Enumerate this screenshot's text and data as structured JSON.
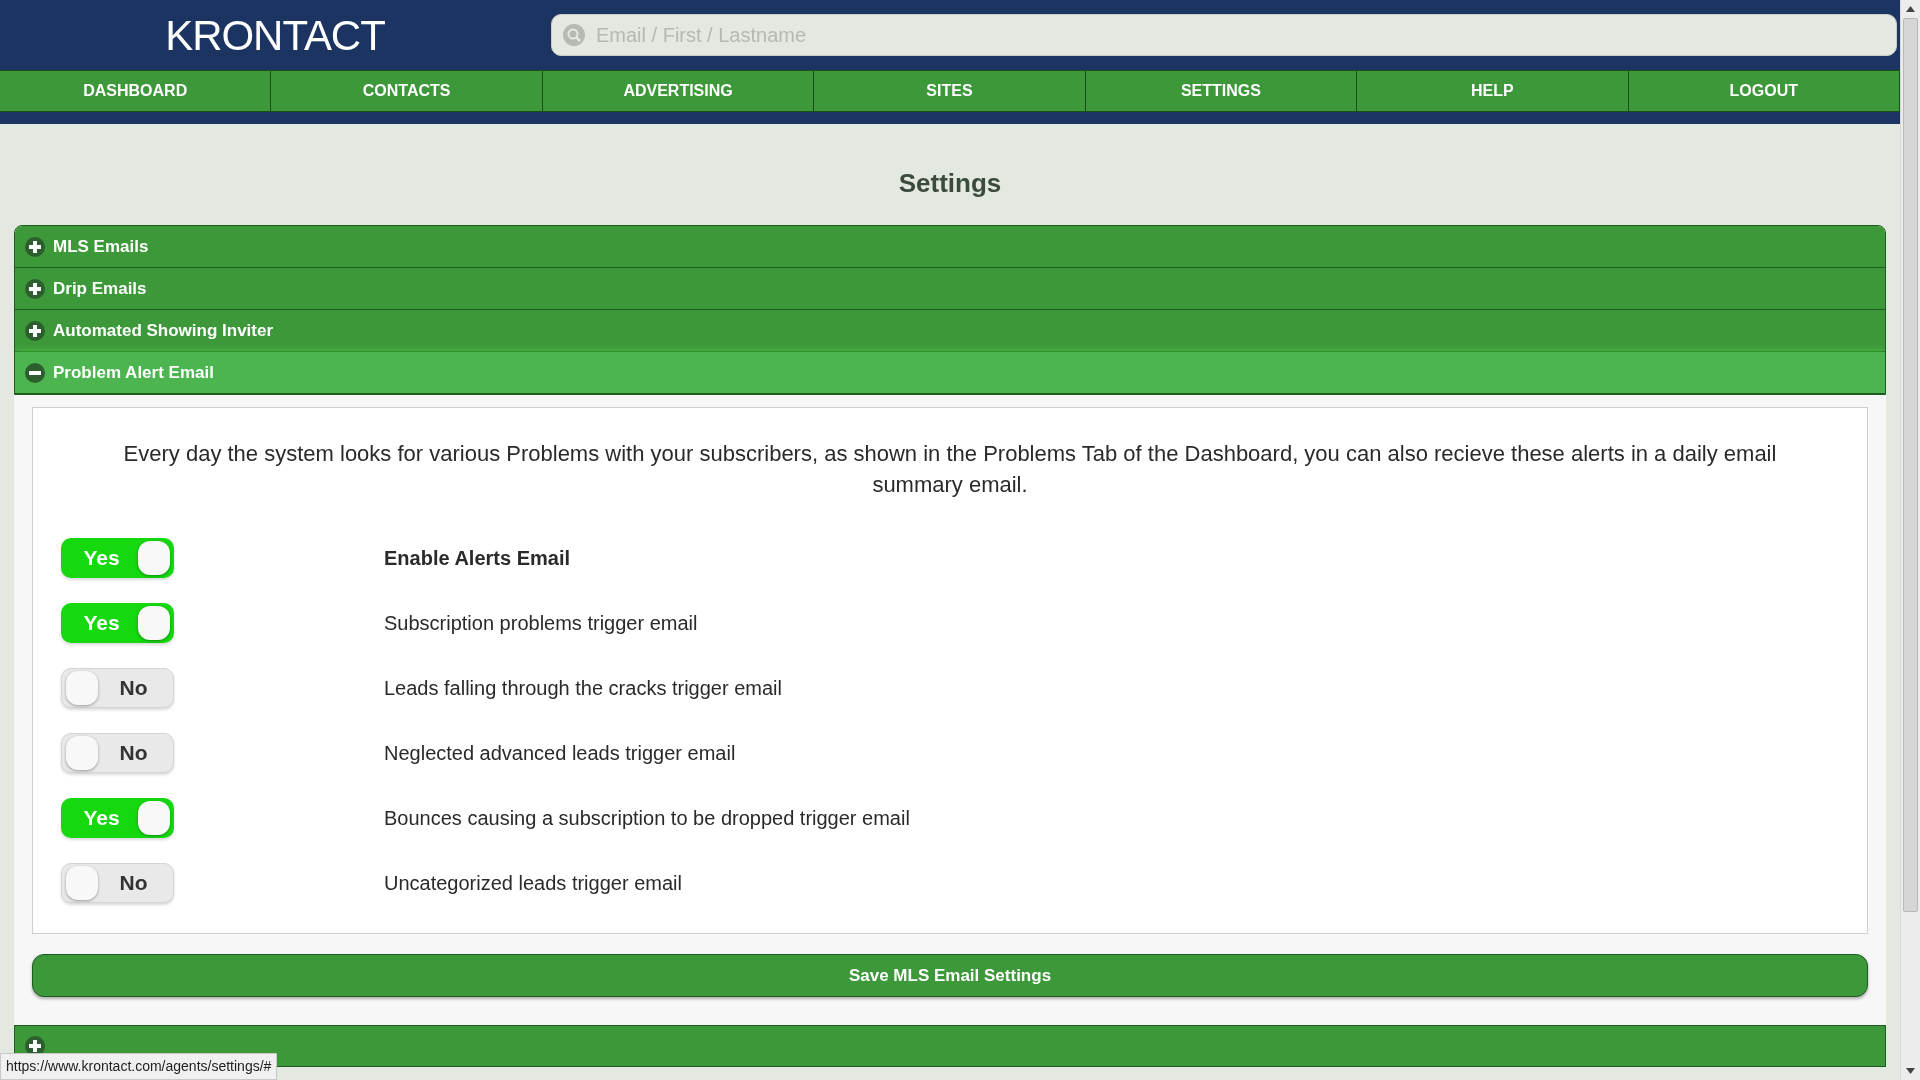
{
  "header": {
    "brand": "KRONTACT",
    "search": {
      "placeholder": "Email / First / Lastname"
    }
  },
  "nav": [
    "DASHBOARD",
    "CONTACTS",
    "ADVERTISING",
    "SITES",
    "SETTINGS",
    "HELP",
    "LOGOUT"
  ],
  "page_title": "Settings",
  "sections": [
    {
      "title": "MLS Emails",
      "expanded": false
    },
    {
      "title": "Drip Emails",
      "expanded": false
    },
    {
      "title": "Automated Showing Inviter",
      "expanded": false
    },
    {
      "title": "Problem Alert Email",
      "expanded": true
    }
  ],
  "panel": {
    "description": "Every day the system looks for various Problems with your subscribers, as shown in the Problems Tab of the Dashboard, you can also recieve these alerts in a daily email summary email.",
    "toggles": [
      {
        "kind": "master",
        "label": "Enable Alerts Email",
        "on": true,
        "text": "Yes"
      },
      {
        "kind": "option",
        "label": "Subscription problems trigger email",
        "on": true,
        "text": "Yes"
      },
      {
        "kind": "option",
        "label": "Leads falling through the cracks trigger email",
        "on": false,
        "text": "No"
      },
      {
        "kind": "option",
        "label": "Neglected advanced leads trigger email",
        "on": false,
        "text": "No"
      },
      {
        "kind": "option",
        "label": "Bounces causing a subscription to be dropped trigger email",
        "on": true,
        "text": "Yes"
      },
      {
        "kind": "option",
        "label": "Uncategorized leads trigger email",
        "on": false,
        "text": "No"
      }
    ],
    "save_button": "Save MLS Email Settings"
  },
  "lower_section": {
    "expanded": false
  },
  "status_bar": {
    "url": "https://www.krontact.com/agents/settings/#"
  }
}
